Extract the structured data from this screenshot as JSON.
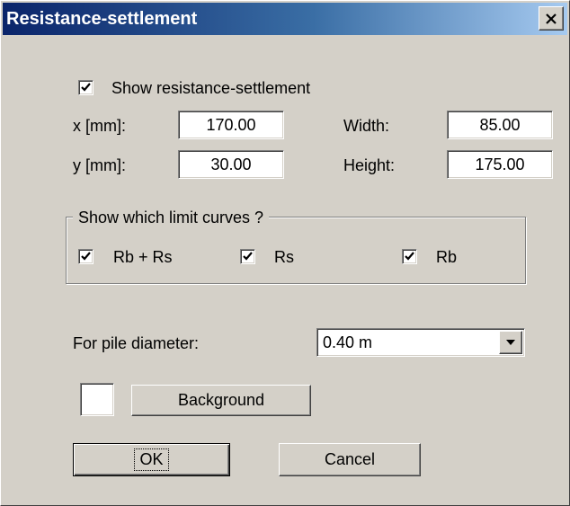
{
  "dialog": {
    "title": "Resistance-settlement",
    "close_label": "×"
  },
  "show_checkbox": {
    "label": "Show resistance-settlement",
    "checked": true
  },
  "fields": {
    "x_label": "x [mm]:",
    "x_value": "170.00",
    "y_label": "y [mm]:",
    "y_value": "30.00",
    "width_label": "Width:",
    "width_value": "85.00",
    "height_label": "Height:",
    "height_value": "175.00"
  },
  "limit_curves": {
    "title": "Show which limit curves ?",
    "options": [
      {
        "label": "Rb + Rs",
        "checked": true
      },
      {
        "label": "Rs",
        "checked": true
      },
      {
        "label": "Rb",
        "checked": true
      }
    ]
  },
  "pile": {
    "label": "For pile diameter:",
    "selected": "0.40 m"
  },
  "background": {
    "button_label": "Background",
    "swatch_color": "#ffffff"
  },
  "buttons": {
    "ok_label": "OK",
    "cancel_label": "Cancel"
  },
  "colors": {
    "title_start": "#0a246a",
    "title_end": "#a6caf0",
    "dialog_bg": "#d4d0c8"
  }
}
